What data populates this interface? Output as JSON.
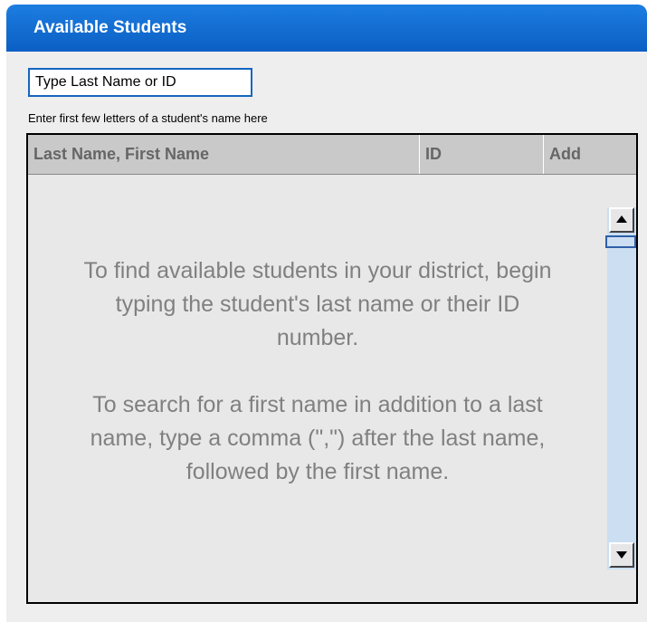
{
  "panel": {
    "title": "Available Students"
  },
  "search": {
    "placeholder": "Type Last Name or ID",
    "value": "",
    "hint": "Enter first few letters of a student's name here"
  },
  "grid": {
    "columns": [
      "Last Name, First Name",
      "ID",
      "Add"
    ],
    "empty_message": [
      "To find available students in your district, begin typing the student's last name or their ID number.",
      "To search for a first name in addition to a last name, type a comma (\",\") after the last name, followed by the first name."
    ]
  },
  "colors": {
    "header_blue": "#0b5fc4",
    "panel_background": "#eeeeee",
    "grid_header": "#c9c9c9",
    "muted_text": "#808080",
    "scrollbar_track": "#ccdff2"
  },
  "icons": {
    "scroll_up": "triangle-up-icon",
    "scroll_down": "triangle-down-icon"
  }
}
